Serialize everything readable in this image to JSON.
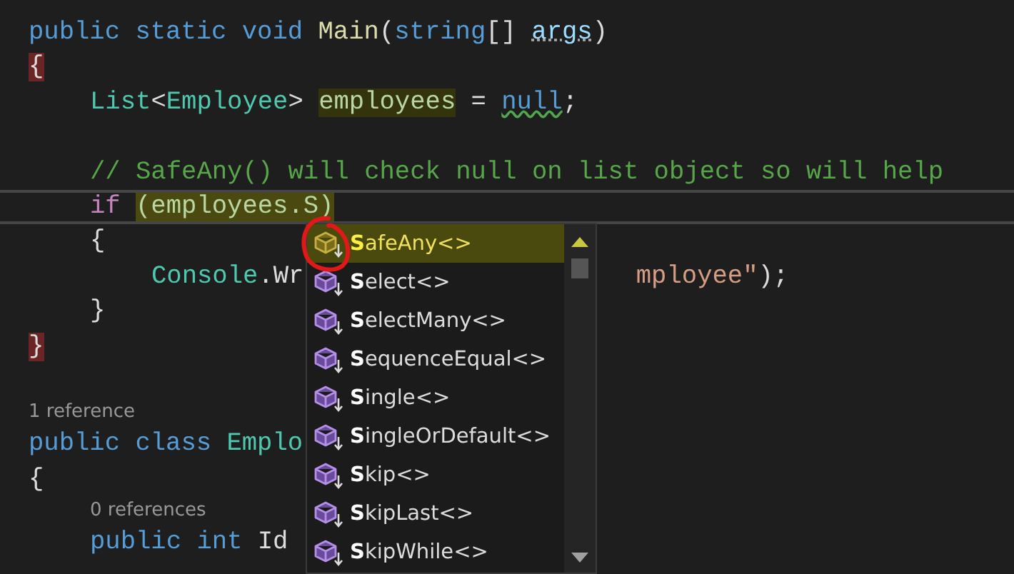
{
  "editor": {
    "lines": [
      {
        "kind": "code",
        "tokens": [
          {
            "text": "public static void ",
            "kind": "keyword"
          },
          {
            "text": "Main",
            "kind": "method"
          },
          {
            "text": "(",
            "kind": "plain"
          },
          {
            "text": "string",
            "kind": "keyword"
          },
          {
            "text": "[] ",
            "kind": "plain"
          },
          {
            "text": "args",
            "kind": "param"
          },
          {
            "text": ")",
            "kind": "plain"
          }
        ]
      },
      {
        "kind": "code",
        "tokens": [
          {
            "text": "{",
            "kind": "brace"
          }
        ],
        "children": [
          {
            "kind": "code",
            "tokens": [
              {
                "text": "List",
                "kind": "type"
              },
              {
                "text": "<",
                "kind": "plain"
              },
              {
                "text": "Employee",
                "kind": "type"
              },
              {
                "text": "> ",
                "kind": "plain"
              },
              {
                "text": "employees",
                "kind": "highlight"
              },
              {
                "text": " = ",
                "kind": "plain"
              },
              {
                "text": "null",
                "kind": "warning"
              },
              {
                "text": ";",
                "kind": "plain"
              }
            ]
          },
          {
            "kind": "blank"
          },
          {
            "kind": "code",
            "tokens": [
              {
                "text": "// SafeAny() will check null on list object so will help",
                "kind": "comment"
              }
            ]
          },
          {
            "kind": "current",
            "tokens": [
              {
                "text": "if ",
                "kind": "control"
              },
              {
                "text": "(employees.S)",
                "kind": "marker"
              }
            ]
          },
          {
            "kind": "code",
            "tokens": [
              {
                "text": "{",
                "kind": "plain"
              }
            ],
            "children": [
              {
                "kind": "code",
                "tokens": [
                  {
                    "text": "Console",
                    "kind": "type"
                  },
                  {
                    "text": ".Wr",
                    "kind": "plain"
                  }
                ],
                "tail": [
                  {
                    "text": "mployee\"",
                    "kind": "string"
                  },
                  {
                    "text": ");",
                    "kind": "plain"
                  }
                ]
              }
            ]
          },
          {
            "kind": "code",
            "tokens": [
              {
                "text": "}",
                "kind": "plain"
              }
            ]
          }
        ]
      },
      {
        "kind": "code",
        "tokens": [
          {
            "text": "}",
            "kind": "brace"
          }
        ]
      },
      {
        "kind": "blank"
      },
      {
        "kind": "codelens",
        "text": "1 reference"
      },
      {
        "kind": "code",
        "tokens": [
          {
            "text": "public class ",
            "kind": "keyword"
          },
          {
            "text": "Emplo",
            "kind": "type"
          }
        ]
      },
      {
        "kind": "code",
        "tokens": [
          {
            "text": "{",
            "kind": "plain"
          }
        ],
        "children": [
          {
            "kind": "codelens",
            "text": "0 references"
          },
          {
            "kind": "code",
            "tokens": [
              {
                "text": "public int ",
                "kind": "keyword"
              },
              {
                "text": "Id",
                "kind": "plain"
              }
            ]
          }
        ]
      }
    ]
  },
  "completion": {
    "items": [
      {
        "label": "**S**afeAny<>",
        "selected": true
      },
      {
        "label": "**S**elect<>",
        "selected": false
      },
      {
        "label": "**S**electMany<>",
        "selected": false
      },
      {
        "label": "**S**equenceEqual<>",
        "selected": false
      },
      {
        "label": "**S**ingle<>",
        "selected": false
      },
      {
        "label": "**S**ingleOrDefault<>",
        "selected": false
      },
      {
        "label": "**S**kip<>",
        "selected": false
      },
      {
        "label": "**S**kipLast<>",
        "selected": false
      },
      {
        "label": "**S**kipWhile<>",
        "selected": false
      }
    ]
  }
}
